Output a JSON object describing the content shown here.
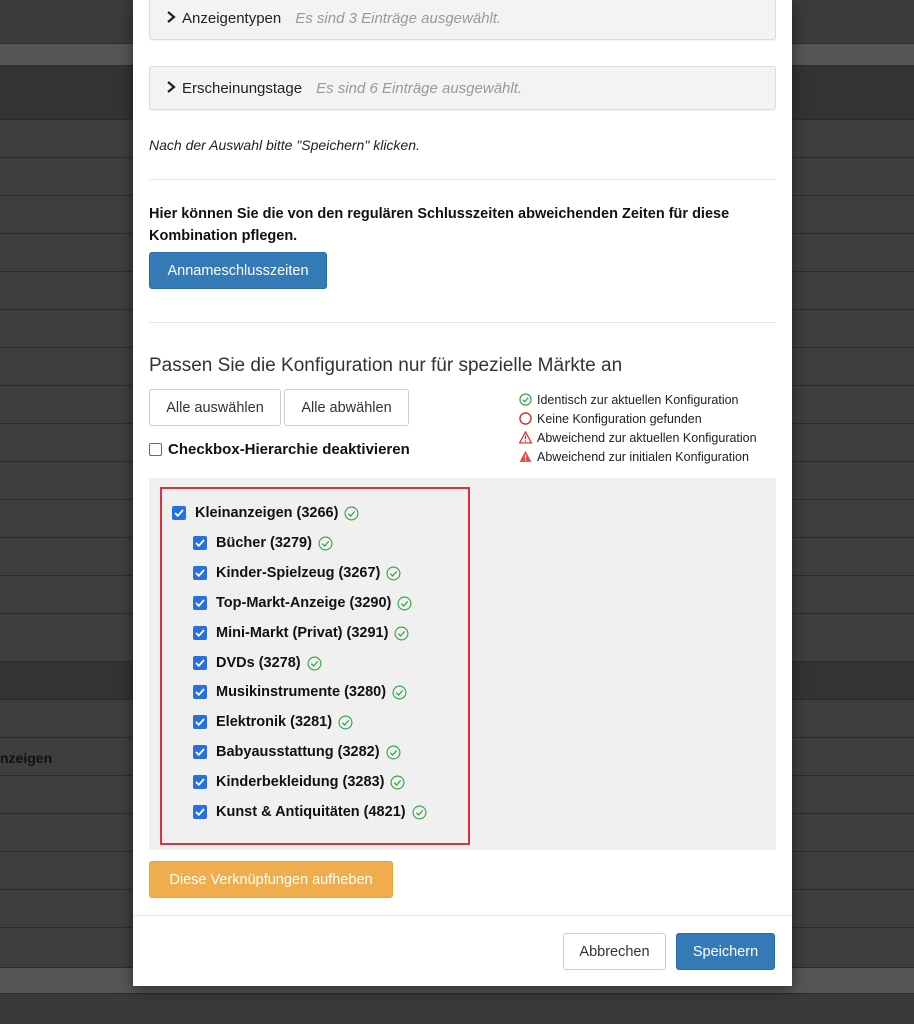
{
  "background": {
    "row_label": "nzeigen"
  },
  "panels": [
    {
      "title": "Anzeigentypen",
      "summary": "Es sind 3 Einträge ausgewählt."
    },
    {
      "title": "Erscheinungstage",
      "summary": "Es sind 6 Einträge ausgewählt."
    }
  ],
  "hint": "Nach der Auswahl bitte \"Speichern\" klicken.",
  "closing_times": {
    "text": "Hier können Sie die von den regulären Schlusszeiten abweichenden Zeiten für diese Kombination pflegen.",
    "button": "Annameschlusszeiten"
  },
  "markets": {
    "title": "Passen Sie die Konfiguration nur für spezielle Märkte an",
    "select_all": "Alle auswählen",
    "deselect_all": "Alle abwählen",
    "hierarchy_checkbox": "Checkbox-Hierarchie deaktivieren",
    "hierarchy_checked": false,
    "legend": [
      {
        "icon": "check-circle-icon",
        "label": "Identisch zur aktuellen Konfiguration",
        "color": "#2e9e3e"
      },
      {
        "icon": "circle-icon",
        "label": "Keine Konfiguration gefunden",
        "color": "#e02020"
      },
      {
        "icon": "warning-outline-icon",
        "label": "Abweichend zur aktuellen Konfiguration",
        "color": "#e02020"
      },
      {
        "icon": "warning-filled-icon",
        "label": "Abweichend zur initialen Konfiguration",
        "color": "#e04848"
      }
    ],
    "tree": {
      "root": {
        "label": "Kleinanzeigen (3266)",
        "checked": true
      },
      "children": [
        {
          "label": "Bücher (3279)",
          "checked": true
        },
        {
          "label": "Kinder-Spielzeug (3267)",
          "checked": true
        },
        {
          "label": "Top-Markt-Anzeige (3290)",
          "checked": true
        },
        {
          "label": "Mini-Markt (Privat) (3291)",
          "checked": true
        },
        {
          "label": "DVDs (3278)",
          "checked": true
        },
        {
          "label": "Musikinstrumente (3280)",
          "checked": true
        },
        {
          "label": "Elektronik (3281)",
          "checked": true
        },
        {
          "label": "Babyausstattung (3282)",
          "checked": true
        },
        {
          "label": "Kinderbekleidung (3283)",
          "checked": true
        },
        {
          "label": "Kunst & Antiquitäten (4821)",
          "checked": true
        }
      ]
    },
    "unlink_button": "Diese Verknüpfungen aufheben"
  },
  "footer": {
    "cancel": "Abbrechen",
    "save": "Speichern"
  },
  "colors": {
    "primary": "#337ab7",
    "warning": "#f0ad4e",
    "checkbox": "#2870e0",
    "highlight_border": "#e03040",
    "ok_icon": "#2e9e3e"
  }
}
